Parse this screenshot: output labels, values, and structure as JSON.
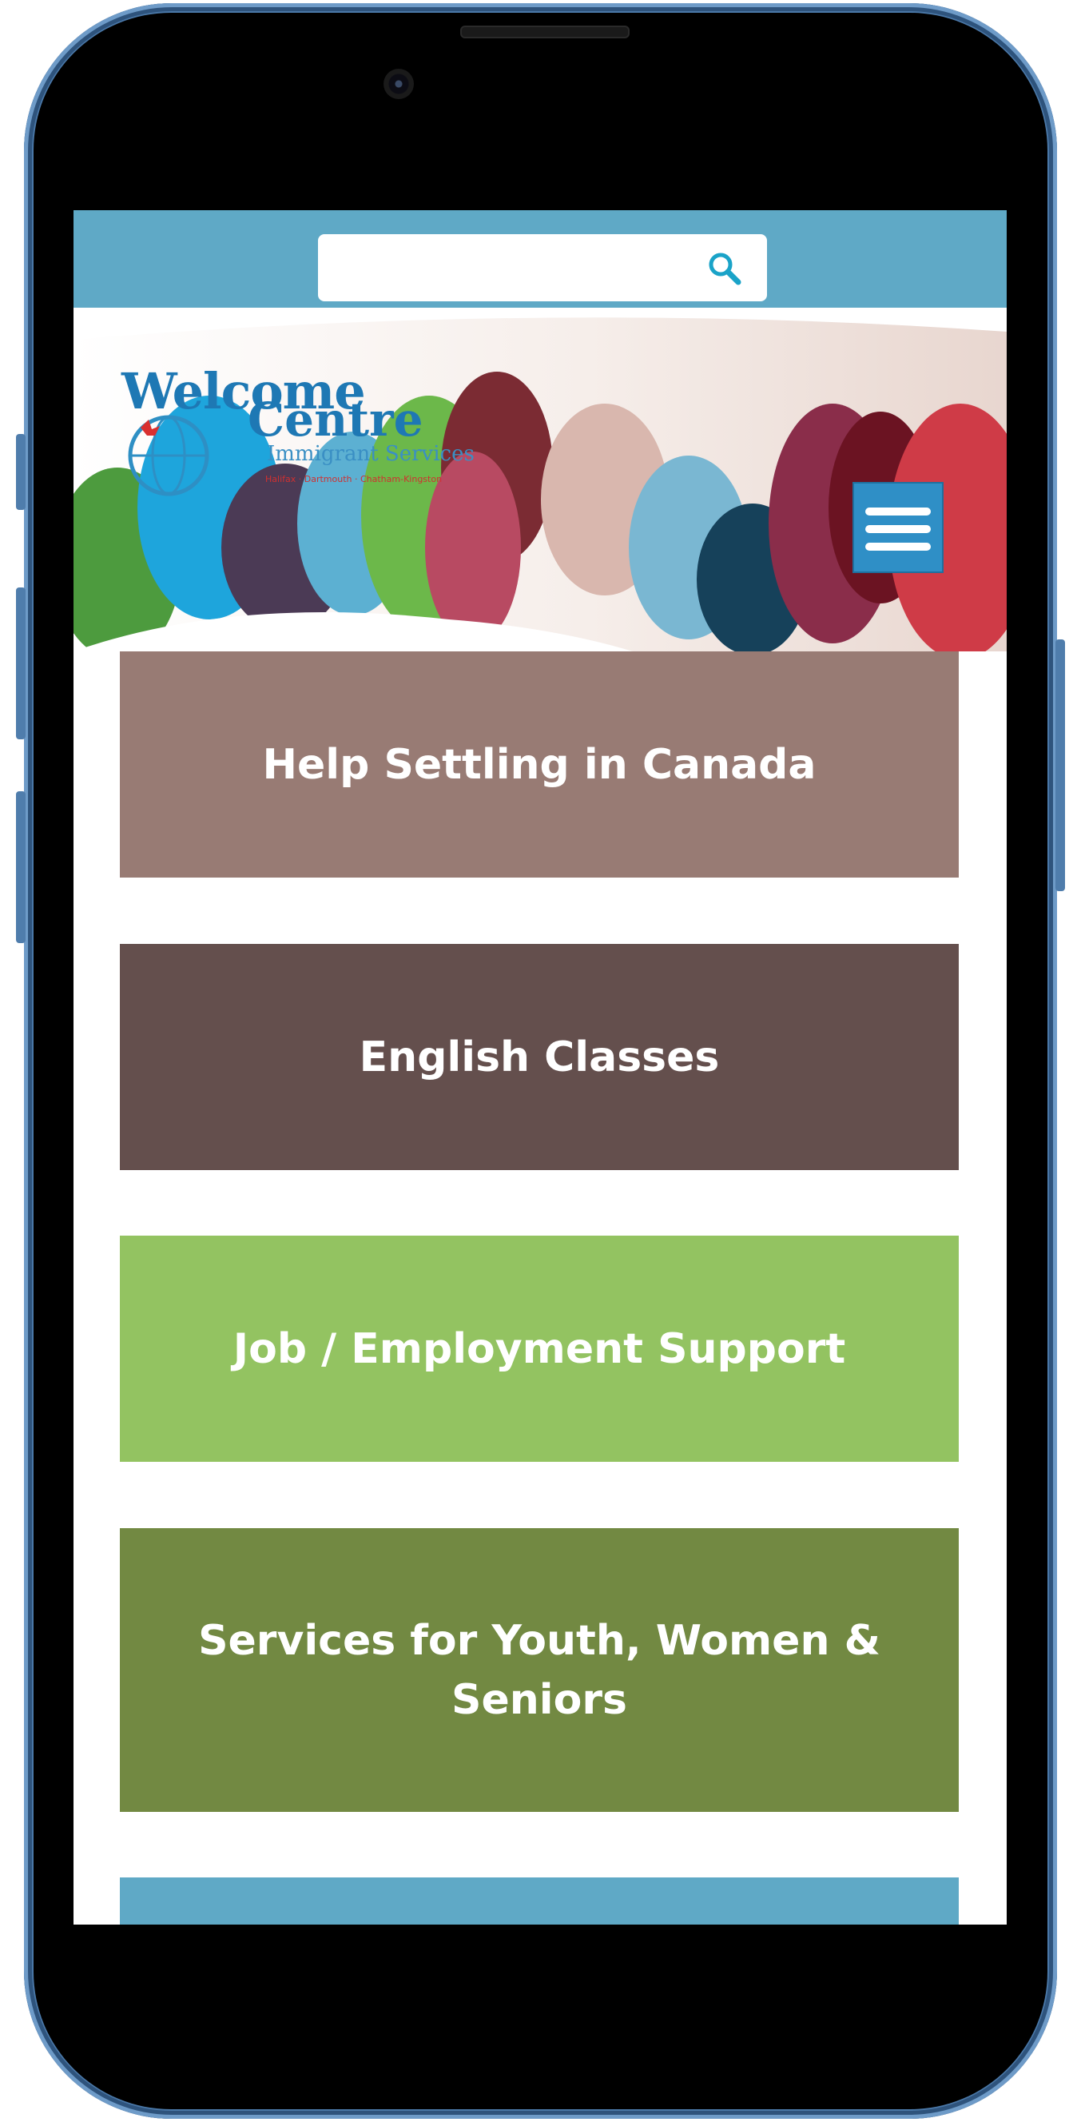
{
  "search": {
    "placeholder": ""
  },
  "logo": {
    "line1": "Welcome",
    "line2": "Centre",
    "line3": "Immigrant Services",
    "tagline": "Halifax · Dartmouth · Chatham-Kingston"
  },
  "tiles": [
    {
      "label": "Help Settling in Canada",
      "color": "#987b74"
    },
    {
      "label": "English Classes",
      "color": "#644f4d"
    },
    {
      "label": "Job / Employment Support",
      "color": "#93c361"
    },
    {
      "label": "Services for Youth, Women & Seniors",
      "color": "#728942"
    },
    {
      "label": "",
      "color": "#5fa9c6"
    }
  ],
  "colors": {
    "topbar": "#5fa9c6",
    "menu_button": "#2f8fc6",
    "phone_frame": "#4a78a8"
  }
}
